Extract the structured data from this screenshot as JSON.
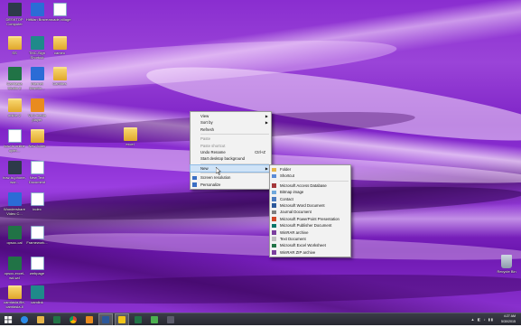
{
  "desktop_icons": [
    {
      "id": "computer",
      "label": "DESKTOP\nComputer",
      "icon": "computer-icon"
    },
    {
      "id": "hitman",
      "label": "HitMan Brave",
      "icon": "shortcut-icon"
    },
    {
      "id": "arcade-village",
      "label": "arcade-village",
      "icon": "file-icon"
    },
    {
      "id": "ss",
      "label": "SS",
      "icon": "folder-icon"
    },
    {
      "id": "tmc",
      "label": "TMC-Sign Shortcut",
      "icon": "shortcut-icon"
    },
    {
      "id": "cameo",
      "label": "cameo",
      "icon": "folder-icon"
    },
    {
      "id": "camtasia",
      "label": "Camtasia Studio 8",
      "icon": "camtasia-icon"
    },
    {
      "id": "internet-download",
      "label": "Internet Downlo...",
      "icon": "ie-icon"
    },
    {
      "id": "camfiles",
      "label": "Camfiles",
      "icon": "folder-icon"
    },
    {
      "id": "online2",
      "label": "online 2",
      "icon": "folder-icon"
    },
    {
      "id": "vlc",
      "label": "VLC media player",
      "icon": "vlc-icon"
    },
    {
      "id": "how-to",
      "label": "how to online open...",
      "icon": "doc-icon"
    },
    {
      "id": "new-folder",
      "label": "New folder",
      "icon": "folder-icon"
    },
    {
      "id": "excel",
      "label": "excel",
      "icon": "folder-icon"
    },
    {
      "id": "aspx",
      "label": "how-to-phone-wor...",
      "icon": "image-icon"
    },
    {
      "id": "new-doc",
      "label": "New Text Document",
      "icon": "doc-icon"
    },
    {
      "id": "wondershare",
      "label": "Wondershare Video C...",
      "icon": "app-icon"
    },
    {
      "id": "index",
      "label": "index",
      "icon": "doc-icon"
    },
    {
      "id": "opsoc",
      "label": "opsoc-cal",
      "icon": "excel-icon"
    },
    {
      "id": "framework",
      "label": "Framework...",
      "icon": "doc-icon"
    },
    {
      "id": "xlsx",
      "label": "opsoc-excel-wd-wd",
      "icon": "excel-icon"
    },
    {
      "id": "webpage",
      "label": "webpage",
      "icon": "doc-icon"
    },
    {
      "id": "camtasia-file",
      "label": "camtasia-file-camtasia-ll",
      "icon": "folder-icon"
    },
    {
      "id": "camlink",
      "label": "camlink",
      "icon": "app-icon"
    },
    {
      "id": "recycle-bin",
      "label": "Recycle Bin",
      "icon": "recycle-bin-icon"
    }
  ],
  "context_menu": {
    "items": [
      {
        "label": "View",
        "submenu": true,
        "disabled": false
      },
      {
        "label": "Sort by",
        "submenu": true,
        "disabled": false
      },
      {
        "label": "Refresh",
        "submenu": false,
        "disabled": false
      },
      {
        "sep": true
      },
      {
        "label": "Paste",
        "submenu": false,
        "disabled": true
      },
      {
        "label": "Paste shortcut",
        "submenu": false,
        "disabled": true
      },
      {
        "label": "Undo Rename",
        "accel": "Ctrl+Z",
        "submenu": false,
        "disabled": false
      },
      {
        "label": "Start desktop background",
        "submenu": false,
        "disabled": false
      },
      {
        "sep": true
      },
      {
        "label": "New",
        "submenu": true,
        "disabled": false,
        "highlighted": true
      },
      {
        "sep": true
      },
      {
        "label": "Screen resolution",
        "icon": "display-icon",
        "submenu": false,
        "disabled": false
      },
      {
        "label": "Personalize",
        "icon": "personalize-icon",
        "submenu": false,
        "disabled": false
      }
    ]
  },
  "new_submenu": {
    "items": [
      {
        "label": "Folder",
        "icon": "folder-icon",
        "color": "#e6b54a"
      },
      {
        "label": "Shortcut",
        "icon": "shortcut-icon",
        "color": "#5b8bd6"
      },
      {
        "sep": true
      },
      {
        "label": "Microsoft Access Database",
        "icon": "access-icon",
        "color": "#a4373a"
      },
      {
        "label": "Bitmap image",
        "icon": "bitmap-icon",
        "color": "#6fa8dc"
      },
      {
        "label": "Contact",
        "icon": "contact-icon",
        "color": "#4a7bbf"
      },
      {
        "label": "Microsoft Word Document",
        "icon": "word-icon",
        "color": "#2b579a"
      },
      {
        "label": "Journal Document",
        "icon": "journal-icon",
        "color": "#7f7f7f"
      },
      {
        "label": "Microsoft PowerPoint Presentation",
        "icon": "powerpoint-icon",
        "color": "#d24726"
      },
      {
        "label": "Microsoft Publisher Document",
        "icon": "publisher-icon",
        "color": "#077568"
      },
      {
        "label": "WinRAR archive",
        "icon": "winrar-icon",
        "color": "#7b3f9e"
      },
      {
        "label": "Text Document",
        "icon": "text-icon",
        "color": "#bfbfbf"
      },
      {
        "label": "Microsoft Excel Worksheet",
        "icon": "excel-icon",
        "color": "#217346"
      },
      {
        "label": "WinRAR ZIP archive",
        "icon": "winrar-zip-icon",
        "color": "#7b3f9e"
      }
    ]
  },
  "taskbar": {
    "clock_time": "4:27 AM",
    "clock_date": "5/30/2015",
    "tray_text": "▲ ◧ ♪ ▮▮"
  }
}
